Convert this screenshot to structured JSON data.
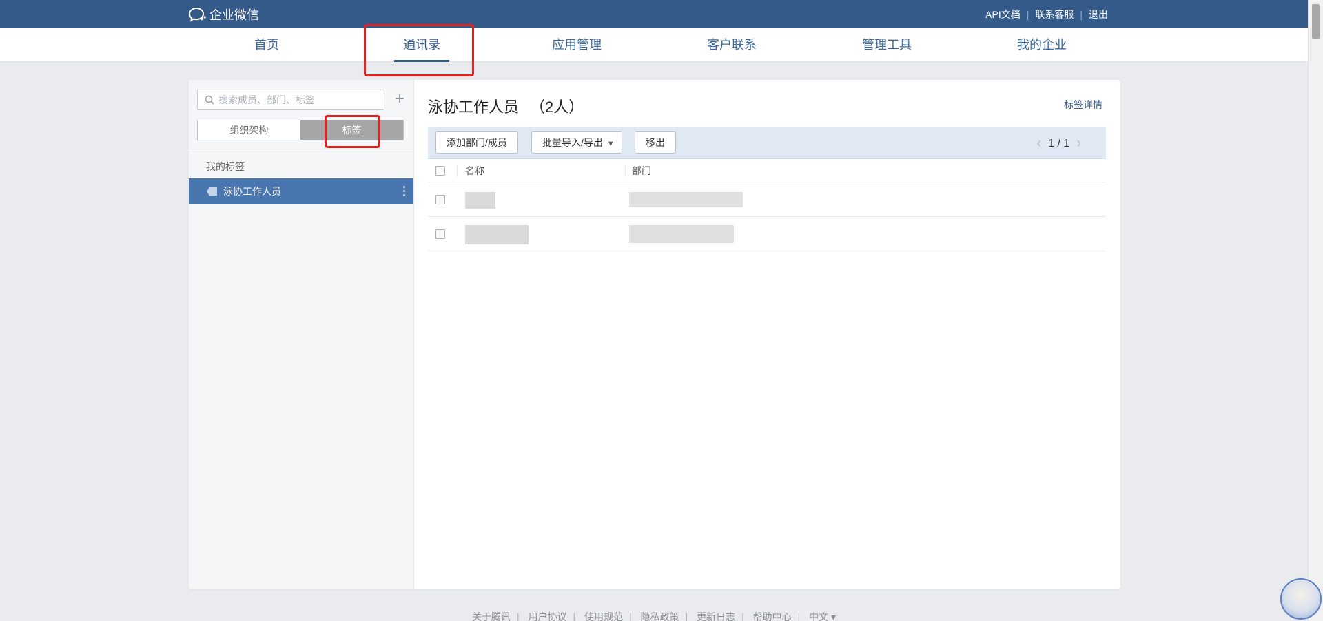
{
  "brand": {
    "name": "企业微信"
  },
  "top_links": [
    "API文档",
    "联系客服",
    "退出"
  ],
  "nav": {
    "items": [
      "首页",
      "通讯录",
      "应用管理",
      "客户联系",
      "管理工具",
      "我的企业"
    ],
    "active": "通讯录"
  },
  "sidebar": {
    "search_placeholder": "搜索成员、部门、标签",
    "add_symbol": "+",
    "segments": [
      "组织架构",
      "标签"
    ],
    "active_segment": "标签",
    "group_label": "我的标签",
    "tags": [
      "泳协工作人员"
    ]
  },
  "content": {
    "title": "泳协工作人员",
    "count": "（2人）",
    "detail_link": "标签详情",
    "toolbar": {
      "add_label": "添加部门/成员",
      "batch_label": "批量导入/导出",
      "remove_label": "移出"
    },
    "pager": {
      "text": "1 / 1"
    },
    "columns": [
      "名称",
      "部门"
    ]
  },
  "footer": {
    "links": [
      "关于腾讯",
      "用户协议",
      "使用规范",
      "隐私政策",
      "更新日志",
      "帮助中心",
      "中文 ▾"
    ]
  },
  "colors": {
    "topbar": "#345a8a",
    "accent": "#4a76b0",
    "annotation": "#e8211e"
  }
}
